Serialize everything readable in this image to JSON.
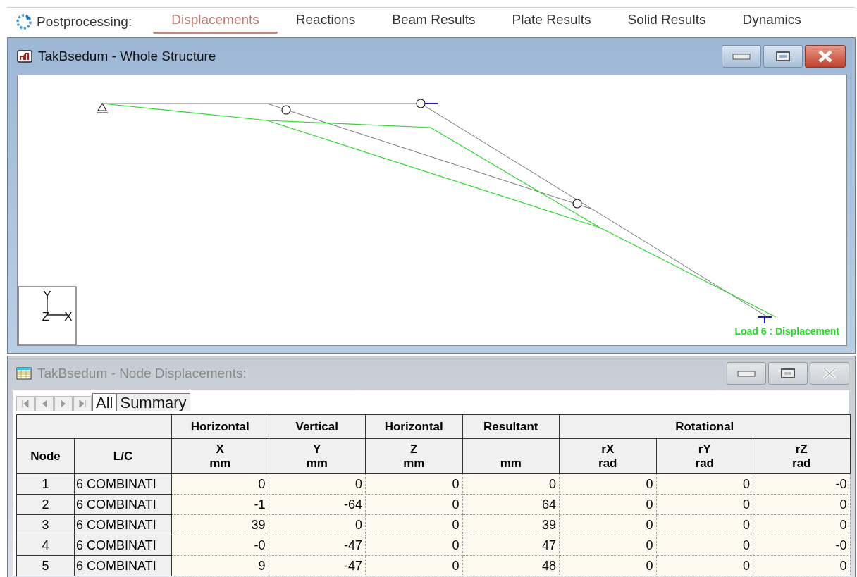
{
  "toolbar": {
    "title": "Postprocessing:",
    "tabs": [
      {
        "label": "Displacements",
        "selected": true
      },
      {
        "label": "Reactions",
        "selected": false
      },
      {
        "label": "Beam Results",
        "selected": false
      },
      {
        "label": "Plate Results",
        "selected": false
      },
      {
        "label": "Solid Results",
        "selected": false
      },
      {
        "label": "Dynamics",
        "selected": false
      }
    ]
  },
  "structure_window": {
    "title": "TakBsedum - Whole Structure",
    "axes": {
      "y": "Y",
      "z": "Z",
      "x": "X"
    },
    "legend": "Load 6 : Displacement"
  },
  "table_window": {
    "title": "TakBsedum - Node Displacements:",
    "sheet_tabs": [
      {
        "label": "All",
        "selected": true
      },
      {
        "label": "Summary",
        "selected": false
      }
    ],
    "table": {
      "node_header": "Node",
      "lc_header": "L/C",
      "groups": [
        {
          "label": "Horizontal",
          "columns": [
            {
              "axis": "X",
              "unit": "mm"
            }
          ]
        },
        {
          "label": "Vertical",
          "columns": [
            {
              "axis": "Y",
              "unit": "mm"
            }
          ]
        },
        {
          "label": "Horizontal",
          "columns": [
            {
              "axis": "Z",
              "unit": "mm"
            }
          ]
        },
        {
          "label": "Resultant",
          "columns": [
            {
              "unit": "mm"
            }
          ]
        },
        {
          "label": "Rotational",
          "columns": [
            {
              "axis": "rX",
              "unit": "rad"
            },
            {
              "axis": "rY",
              "unit": "rad"
            },
            {
              "axis": "rZ",
              "unit": "rad"
            }
          ]
        }
      ],
      "rows": [
        {
          "node": "1",
          "lc": "6 COMBINATI",
          "values": [
            "0",
            "0",
            "0",
            "0",
            "0",
            "0",
            "-0"
          ]
        },
        {
          "node": "2",
          "lc": "6 COMBINATI",
          "values": [
            "-1",
            "-64",
            "0",
            "64",
            "0",
            "0",
            "0"
          ]
        },
        {
          "node": "3",
          "lc": "6 COMBINATI",
          "values": [
            "39",
            "0",
            "0",
            "39",
            "0",
            "0",
            "0"
          ]
        },
        {
          "node": "4",
          "lc": "6 COMBINATI",
          "values": [
            "-0",
            "-47",
            "0",
            "47",
            "0",
            "0",
            "-0"
          ]
        },
        {
          "node": "5",
          "lc": "6 COMBINATI",
          "values": [
            "9",
            "-47",
            "0",
            "48",
            "0",
            "0",
            "0"
          ]
        }
      ]
    }
  }
}
